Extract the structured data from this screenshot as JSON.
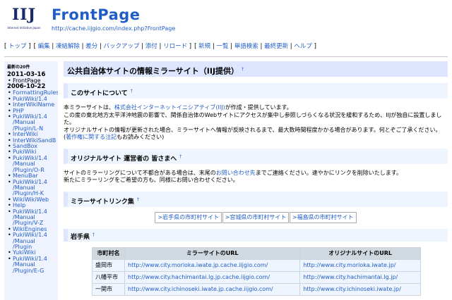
{
  "header": {
    "logo_text": "IIJ",
    "logo_sub": "Internet Initiative Japan",
    "site_title": "FrontPage",
    "site_url": "http://cache.iijgio.com/index.php?FrontPage"
  },
  "navbar": {
    "groups": [
      [
        "トップ"
      ],
      [
        "編集",
        "凍結解除",
        "差分",
        "バックアップ",
        "添付",
        "リロード"
      ],
      [
        "新規",
        "一覧",
        "単語検索",
        "最終更新",
        "ヘルプ"
      ]
    ]
  },
  "menubar": {
    "title": "最新の20件",
    "date1": "2011-03-16",
    "items_date1": [
      {
        "label": "FrontPage",
        "plain": true
      }
    ],
    "date2": "2006-10-22",
    "items_date2": [
      {
        "label": "FormattingRules"
      },
      {
        "label": "PukiWiki/1.4"
      },
      {
        "label": "InterWikiName"
      },
      {
        "label": "PHP"
      },
      {
        "label": "PukiWiki/1.4\n/Manual\n/Plugin/L-N"
      },
      {
        "label": "InterWiki"
      },
      {
        "label": "InterWikiSandB"
      },
      {
        "label": "SandBox"
      },
      {
        "label": "PukiWiki"
      },
      {
        "label": "PukiWiki/1.4\n/Manual\n/Plugin/O-R"
      },
      {
        "label": "MenuBar"
      },
      {
        "label": "PukiWiki/1.4\n/Manual\n/Plugin/H-K"
      },
      {
        "label": "WikiWikiWeb"
      },
      {
        "label": "Help"
      },
      {
        "label": "PukiWiki/1.4\n/Manual\n/Plugin/V-Z"
      },
      {
        "label": "WikiEngines"
      },
      {
        "label": "PukiWiki/1.4\n/Manual\n/Plugin"
      },
      {
        "label": "YukiWiki"
      },
      {
        "label": "PukiWiki/1.4\n/Manual\n/Plugin/E-G"
      }
    ]
  },
  "main": {
    "page_title": "公共自治体サイトの情報ミラーサイト（IIJ提供）",
    "anchor": "†",
    "about": {
      "heading": "このサイトについて",
      "line1_pre": "本ミラーサイトは、",
      "line1_link": "株式会社インターネットイニシアティブ(IIJ)",
      "line1_post": "が作成・提供しています。",
      "line2": "この度の東北地方太平洋沖地震の影響で、関係自治体のWebサイトにアクセスが集中し参照しづらくなる状況を緩和するため、IIJが独自に設置しました。",
      "line3": "オリジナルサイトの情報が更新された場合、ミラーサイトへ情報が反映されるまで、最大数時間程度かかる場合があります。何とぞご了承ください。",
      "line4_pre": "(",
      "line4_link": "著作権に関する注記",
      "line4_post": "もお読みください)"
    },
    "operators": {
      "heading": "オリジナルサイト 運営者の 皆さまへ",
      "line1_pre": "サイトのミラーリングについて不都合がある場合は、末尾の",
      "line1_link": "お問い合わせ先",
      "line1_post": "までご連絡ください。速やかにリンクを削除いたします。",
      "line2": "新たにミラーリングをご希望の方も、同様にお問い合わせください。"
    },
    "mirror_links": {
      "heading": "ミラーサイトリンク集",
      "buttons": [
        ">岩手県の市町村サイト",
        ">宮城県の市町村サイト",
        ">福島県の市町村サイト"
      ]
    },
    "iwate": {
      "heading": "岩手県",
      "columns": [
        "市町村名",
        "ミラーサイトのURL",
        "オリジナルサイトのURL"
      ],
      "rows": [
        {
          "city": "盛岡市",
          "mirror": "http://www.city.morioka.iwate.jp.cache.iijgio.com/",
          "original": "http://www.city.morioka.iwate.jp/"
        },
        {
          "city": "八幡平市",
          "mirror": "http://www.city.hachimantai.lg.jp.cache.iijgio.com/",
          "original": "http://www.city.hachimantai.lg.jp/"
        },
        {
          "city": "一関市",
          "mirror": "http://www.city.ichinoseki.iwate.jp.cache.iijgio.com/",
          "original": "http://www.city.ichinoseki.iwate.jp/"
        }
      ]
    }
  }
}
